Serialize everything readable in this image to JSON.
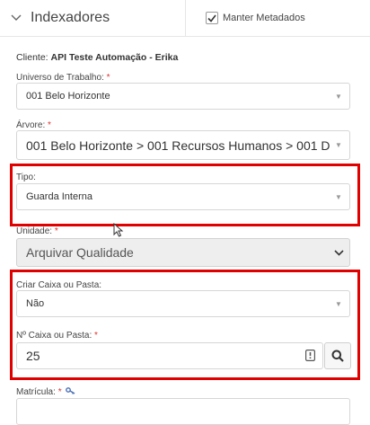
{
  "header": {
    "title": "Indexadores",
    "keep_metadata_label": "Manter Metadados",
    "keep_metadata_checked": true
  },
  "client": {
    "label": "Cliente:",
    "value": "API Teste Automação - Erika"
  },
  "fields": {
    "universo": {
      "label": "Universo de Trabalho:",
      "required": "*",
      "value": "001 Belo Horizonte"
    },
    "arvore": {
      "label": "Árvore:",
      "required": "*",
      "value": "001 Belo Horizonte > 001 Recursos Humanos > 001 D"
    },
    "tipo": {
      "label": "Tipo:",
      "value": "Guarda Interna"
    },
    "unidade": {
      "label": "Unidade:",
      "required": "*",
      "value": "Arquivar Qualidade"
    },
    "criar": {
      "label": "Criar Caixa ou Pasta:",
      "value": "Não"
    },
    "numero": {
      "label": "Nº Caixa ou Pasta:",
      "required": "*",
      "value": "25"
    },
    "matricula": {
      "label": "Matrícula:",
      "required": "*"
    }
  },
  "icons": [
    "chevron-down-icon",
    "checkmark-icon",
    "caret-down-icon",
    "calculator-icon",
    "magnifier-icon",
    "key-icon",
    "mouse-cursor-icon"
  ],
  "colors": {
    "highlight": "#e00000",
    "required": "#dd3333",
    "disabled_bg": "#eeeeee"
  }
}
